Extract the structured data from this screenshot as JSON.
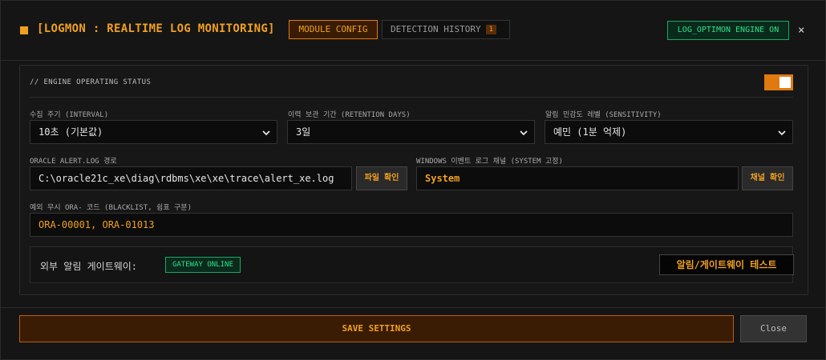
{
  "header": {
    "title": "[LOGMON : REALTIME LOG MONITORING]",
    "tabs": [
      {
        "label": "MODULE CONFIG"
      },
      {
        "label": "DETECTION HISTORY",
        "badge": "1"
      }
    ],
    "engine_status": "LOG_OPTIMON ENGINE ON",
    "close_symbol": "×"
  },
  "section": {
    "title": "// ENGINE OPERATING STATUS",
    "toggle_on": true
  },
  "fields": {
    "interval": {
      "label": "수집 주기 (INTERVAL)",
      "value": "10초 (기본값)"
    },
    "retention": {
      "label": "이력 보관 기간 (RETENTION DAYS)",
      "value": "3일"
    },
    "sensitivity": {
      "label": "알림 민감도 레벨 (SENSITIVITY)",
      "value": "예민 (1분 억제)"
    },
    "alert_log": {
      "label": "ORACLE ALERT.LOG 경로",
      "value": "C:\\oracle21c_xe\\diag\\rdbms\\xe\\xe\\trace\\alert_xe.log",
      "button": "파일 확인"
    },
    "event_channel": {
      "label": "WINDOWS 이벤트 로그 채널 (SYSTEM 고정)",
      "value": "System",
      "button": "채널 확인"
    },
    "blacklist": {
      "label": "예외 무시 ORA- 코드 (BLACKLIST, 쉼표 구분)",
      "value": "ORA-00001, ORA-01013"
    }
  },
  "gateway": {
    "label": "외부 알림 게이트웨이:",
    "status": "GATEWAY ONLINE",
    "test_button": "알림/게이트웨이 테스트"
  },
  "footer": {
    "save_label": "SAVE SETTINGS",
    "close_label": "Close"
  },
  "colors": {
    "accent": "#f0a020",
    "accent_dark": "#e07a10",
    "online_green": "#2fe08a"
  }
}
